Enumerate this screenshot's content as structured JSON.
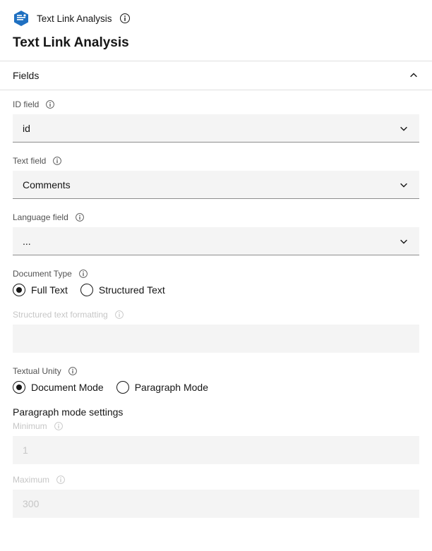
{
  "header": {
    "node_label": "Text Link Analysis",
    "page_title": "Text Link Analysis"
  },
  "section": {
    "title": "Fields"
  },
  "id_field": {
    "label": "ID field",
    "value": "id"
  },
  "text_field": {
    "label": "Text field",
    "value": "Comments"
  },
  "language_field": {
    "label": "Language field",
    "value": "..."
  },
  "document_type": {
    "label": "Document Type",
    "option_full": "Full Text",
    "option_structured": "Structured Text"
  },
  "structured_text": {
    "label": "Structured text formatting",
    "value": ""
  },
  "textual_unity": {
    "label": "Textual Unity",
    "option_doc": "Document Mode",
    "option_para": "Paragraph Mode"
  },
  "paragraph_settings": {
    "title": "Paragraph mode settings",
    "min_label": "Minimum",
    "min_value": "1",
    "max_label": "Maximum",
    "max_value": "300"
  }
}
